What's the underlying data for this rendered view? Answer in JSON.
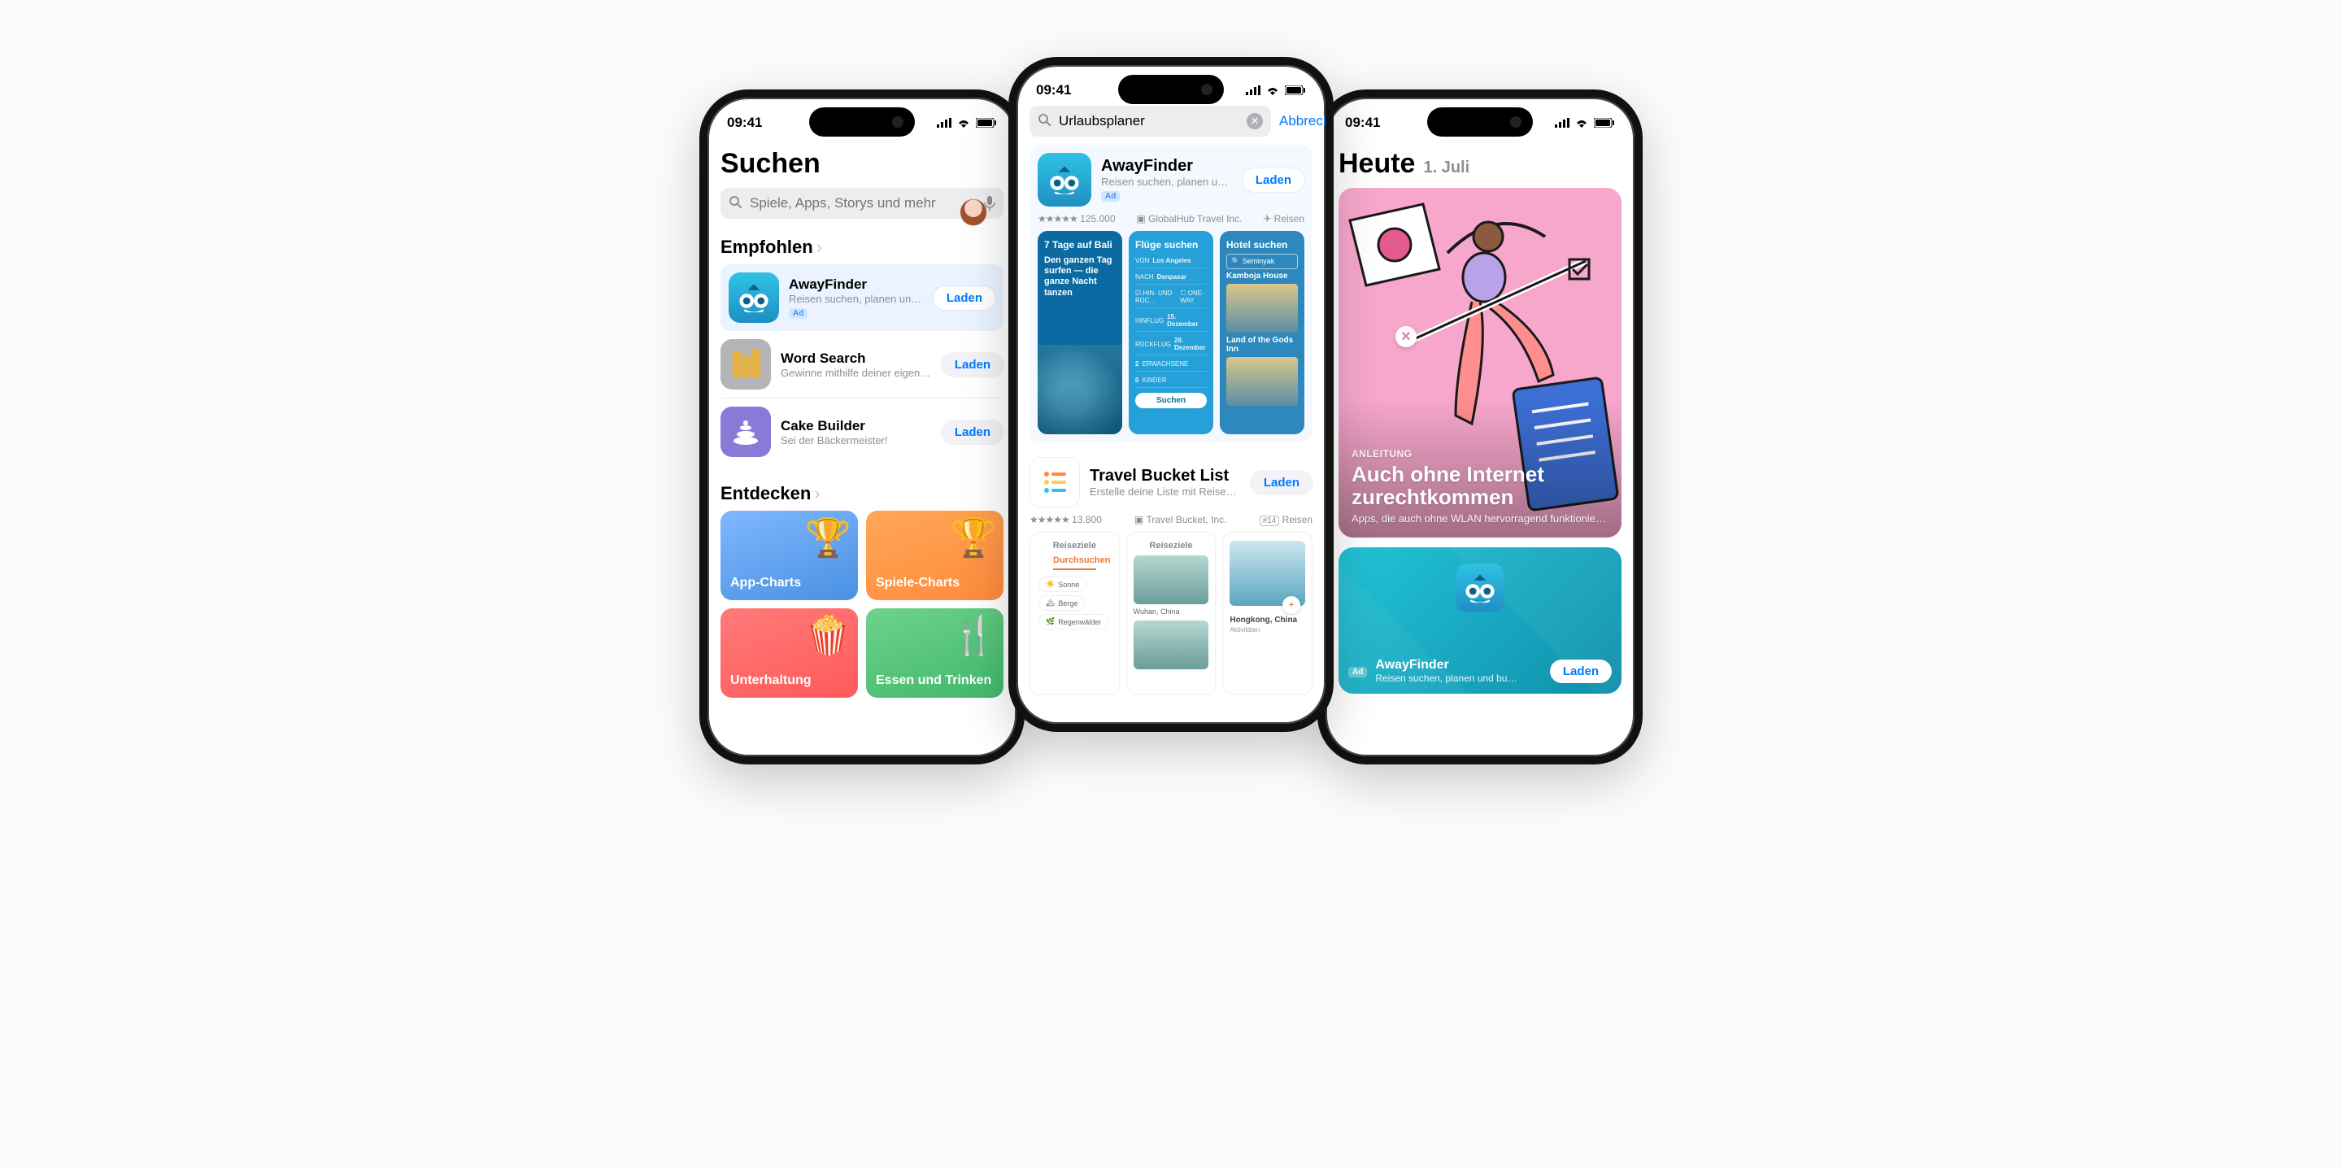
{
  "status": {
    "time": "09:41"
  },
  "common": {
    "ad_badge": "Ad",
    "load_button": "Laden"
  },
  "left": {
    "title": "Suchen",
    "search_placeholder": "Spiele, Apps, Storys und mehr",
    "recommended_header": "Empfohlen",
    "discover_header": "Entdecken",
    "recommended": [
      {
        "name": "AwayFinder",
        "sub": "Reisen suchen, planen und buc…",
        "ad": true
      },
      {
        "name": "Word Search",
        "sub": "Gewinne mithilfe deiner eigene…",
        "ad": false
      },
      {
        "name": "Cake Builder",
        "sub": "Sei der Bäckermeister!",
        "ad": false
      }
    ],
    "discover": [
      {
        "label": "App-Charts"
      },
      {
        "label": "Spiele-Charts"
      },
      {
        "label": "Unterhaltung"
      },
      {
        "label": "Essen und Trinken"
      }
    ]
  },
  "mid": {
    "search_value": "Urlaubsplaner",
    "cancel": "Abbrechen",
    "result": {
      "name": "AwayFinder",
      "sub": "Reisen suchen, planen und bu…",
      "rating_count": "125.000",
      "developer": "GlobalHub Travel Inc.",
      "category": "Reisen",
      "screens": {
        "s1": {
          "headline": "7 Tage auf Bali",
          "tag": "Den ganzen Tag surfen — die ganze Nacht tanzen"
        },
        "s2": {
          "title": "Flüge suchen",
          "from_label": "VON",
          "from": "Los Angeles",
          "to_label": "NACH",
          "to": "Denpasar",
          "trip1": "HIN- UND RÜC…",
          "trip2": "ONE-WAY",
          "dep_label": "HINFLUG",
          "dep": "15. Dezember",
          "ret_label": "RÜCKFLUG",
          "ret": "28. Dezember",
          "adults_n": "2",
          "adults": "ERWACHSENE",
          "kids_n": "0",
          "kids": "KINDER",
          "cta": "Suchen"
        },
        "s3": {
          "title": "Hotel suchen",
          "search": "Seminyak",
          "hotel1": "Kamboja House",
          "hotel2": "Land of the Gods Inn"
        }
      }
    },
    "result2": {
      "name": "Travel Bucket List",
      "sub": "Erstelle deine Liste mit Reisez…",
      "rating_count": "13.800",
      "developer": "Travel Bucket, Inc.",
      "rank": "#14",
      "category": "Reisen",
      "screens": {
        "s1": {
          "title": "Reiseziele",
          "cta": "Durchsuchen",
          "chips": [
            "Sonne",
            "Berge",
            "Regenwälder"
          ]
        },
        "s2": {
          "title": "Reiseziele",
          "caption": "Wuhan, China"
        },
        "s3": {
          "title": "Hongkong, China",
          "section": "Aktivitäten"
        }
      }
    }
  },
  "right": {
    "title": "Heute",
    "date": "1. Juli",
    "card": {
      "eyebrow": "ANLEITUNG",
      "headline": "Auch ohne Internet zurechtkommen",
      "desc": "Apps, die auch ohne WLAN hervorragend funktionieren."
    },
    "strip": {
      "name": "AwayFinder",
      "sub": "Reisen suchen, planen und bu…"
    }
  }
}
